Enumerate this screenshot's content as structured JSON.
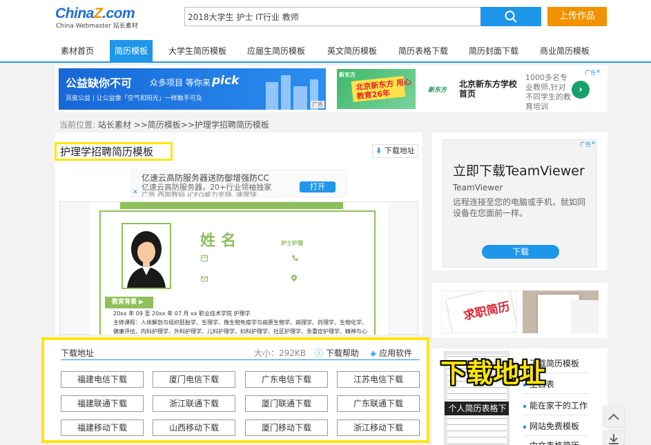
{
  "header": {
    "logo_brand_a": "China",
    "logo_brand_z": "Z",
    "logo_brand_b": ".com",
    "logo_sub": "China Webmaster 站长素材",
    "search_value": "2018大学生 护士 IT行业 教师",
    "upload_label": "上传作品"
  },
  "nav": {
    "items": [
      {
        "label": "素材首页"
      },
      {
        "label": "简历模板"
      },
      {
        "label": "大学生简历模板"
      },
      {
        "label": "应届生简历模板"
      },
      {
        "label": "英文简历模板"
      },
      {
        "label": "简历表格下载"
      },
      {
        "label": "简历封面下载"
      },
      {
        "label": "商业简历模板"
      }
    ]
  },
  "ads": {
    "left": {
      "title": "公益缺你不可",
      "mid": "众多项目 等你来",
      "brand": "pick",
      "tagline": "百度公益 | 让公益像「空气和阳光」一样触手可及",
      "tag": "广告"
    },
    "right": {
      "thumb_logo": "新东方",
      "thumb_text": "北京新东方 用心教育26年",
      "logo": "新东方",
      "title": "北京新东方学校首页",
      "desc": "1000多名专业教师,针对不同学生的教育培训",
      "tag": "广告"
    }
  },
  "breadcrumb": {
    "label": "当前位置:",
    "path": "站长素材 >>简历模板>>护理学招聘简历模板"
  },
  "main": {
    "title": "护理学招聘简历模板",
    "download_link": "下载地址",
    "mini_ad": {
      "line1": "亿速云高防服务器送防御增强防CC",
      "line2": "亿速云高防服务器，20+行业领袖独家",
      "line3": "广告 西部数码 ICEO威力支持, 速度快",
      "button": "打开"
    },
    "resume": {
      "name": "姓名",
      "job": "护士护理",
      "section": "教育背景",
      "row1": "20xx 年 09 至 20xx 年 07 月           xx 职业技术学院                     护理学",
      "row2": "主修课程：人体解剖与组织胚胎学、生理学、微生物免疫学与病原生物学、病理学、药理学、生物化学、",
      "row3": "健康评估、内科护理学、外科护理学、儿科护理学、妇科护理学、社区护理学、急重症护理学、精神与心"
    }
  },
  "download_panel": {
    "heading": "下载地址",
    "size": "大小：292KB",
    "help": "下载帮助",
    "software": "应用软件",
    "buttons": [
      "福建电信下载",
      "厦门电信下载",
      "广东电信下载",
      "江苏电信下载",
      "福建联通下载",
      "浙江联通下载",
      "厦门联通下载",
      "广东联通下载",
      "福建移动下载",
      "山西移动下载",
      "厦门移动下载",
      "浙江移动下载"
    ]
  },
  "right": {
    "tv_ad": {
      "headline": "立即下载TeamViewer",
      "brand": "TeamViewer",
      "desc": "远程连接至您的电脑或手机，就如同设备在您面前一样。",
      "button": "下载",
      "tag": "广告"
    },
    "thumb1_text": "求职简历",
    "related_caption": "个人简历表格下",
    "related_items": [
      "下载简历模板",
      "空白表",
      "能在家干的工作",
      "网站免费模板",
      "中文表格简历"
    ],
    "overlay_text": "下载地址"
  },
  "colors": {
    "accent_blue": "#1e96ea",
    "accent_orange": "#f29200",
    "highlight_yellow": "#ffe600",
    "resume_green": "#8dc05a"
  }
}
